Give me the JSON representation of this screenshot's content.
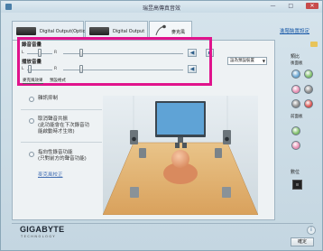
{
  "window": {
    "title": "瑞昱高傳真音效",
    "controls": [
      "—",
      "□",
      "✕"
    ]
  },
  "tabs": [
    {
      "label": "Digital Output(Optical)"
    },
    {
      "label": "Digital Output"
    },
    {
      "label": "麥克風"
    }
  ],
  "advanced_link": "進階裝置設定",
  "volume": {
    "record_label": "錄音音量",
    "playback_label": "播放音量",
    "left": "L",
    "right": "R",
    "record_level": 0.15,
    "record_balance": 0.5,
    "playback_level": 0.15,
    "playback_balance": 0.1
  },
  "default_device": "設為預設裝置",
  "env_tabs": [
    "麥克風效果",
    "預設格式"
  ],
  "options": [
    {
      "label": "雜訊抑制"
    },
    {
      "label": "取消聲音共振\n(此功能會在下次錄音功\n能啟動時才生效)"
    },
    {
      "label": "指向性錄音功能\n(只對前方的聲音功能)"
    }
  ],
  "calibrate_link": "麥克風校正",
  "ports": {
    "analog_title": "類比",
    "rear_label": "後面板",
    "front_label": "前面板",
    "digital_label": "數位",
    "colors": {
      "rear": [
        "#6aa7d3",
        "#7fbf6a",
        "#e78fb3",
        "#8a8a8a",
        "#8a8a8a",
        "#d9534f"
      ],
      "front": [
        "#7fbf6a",
        "#e78fb3"
      ]
    }
  },
  "footer": {
    "brand": "GIGABYTE",
    "brand_sub": "TECHNOLOGY",
    "ok": "確定",
    "info": "i"
  }
}
